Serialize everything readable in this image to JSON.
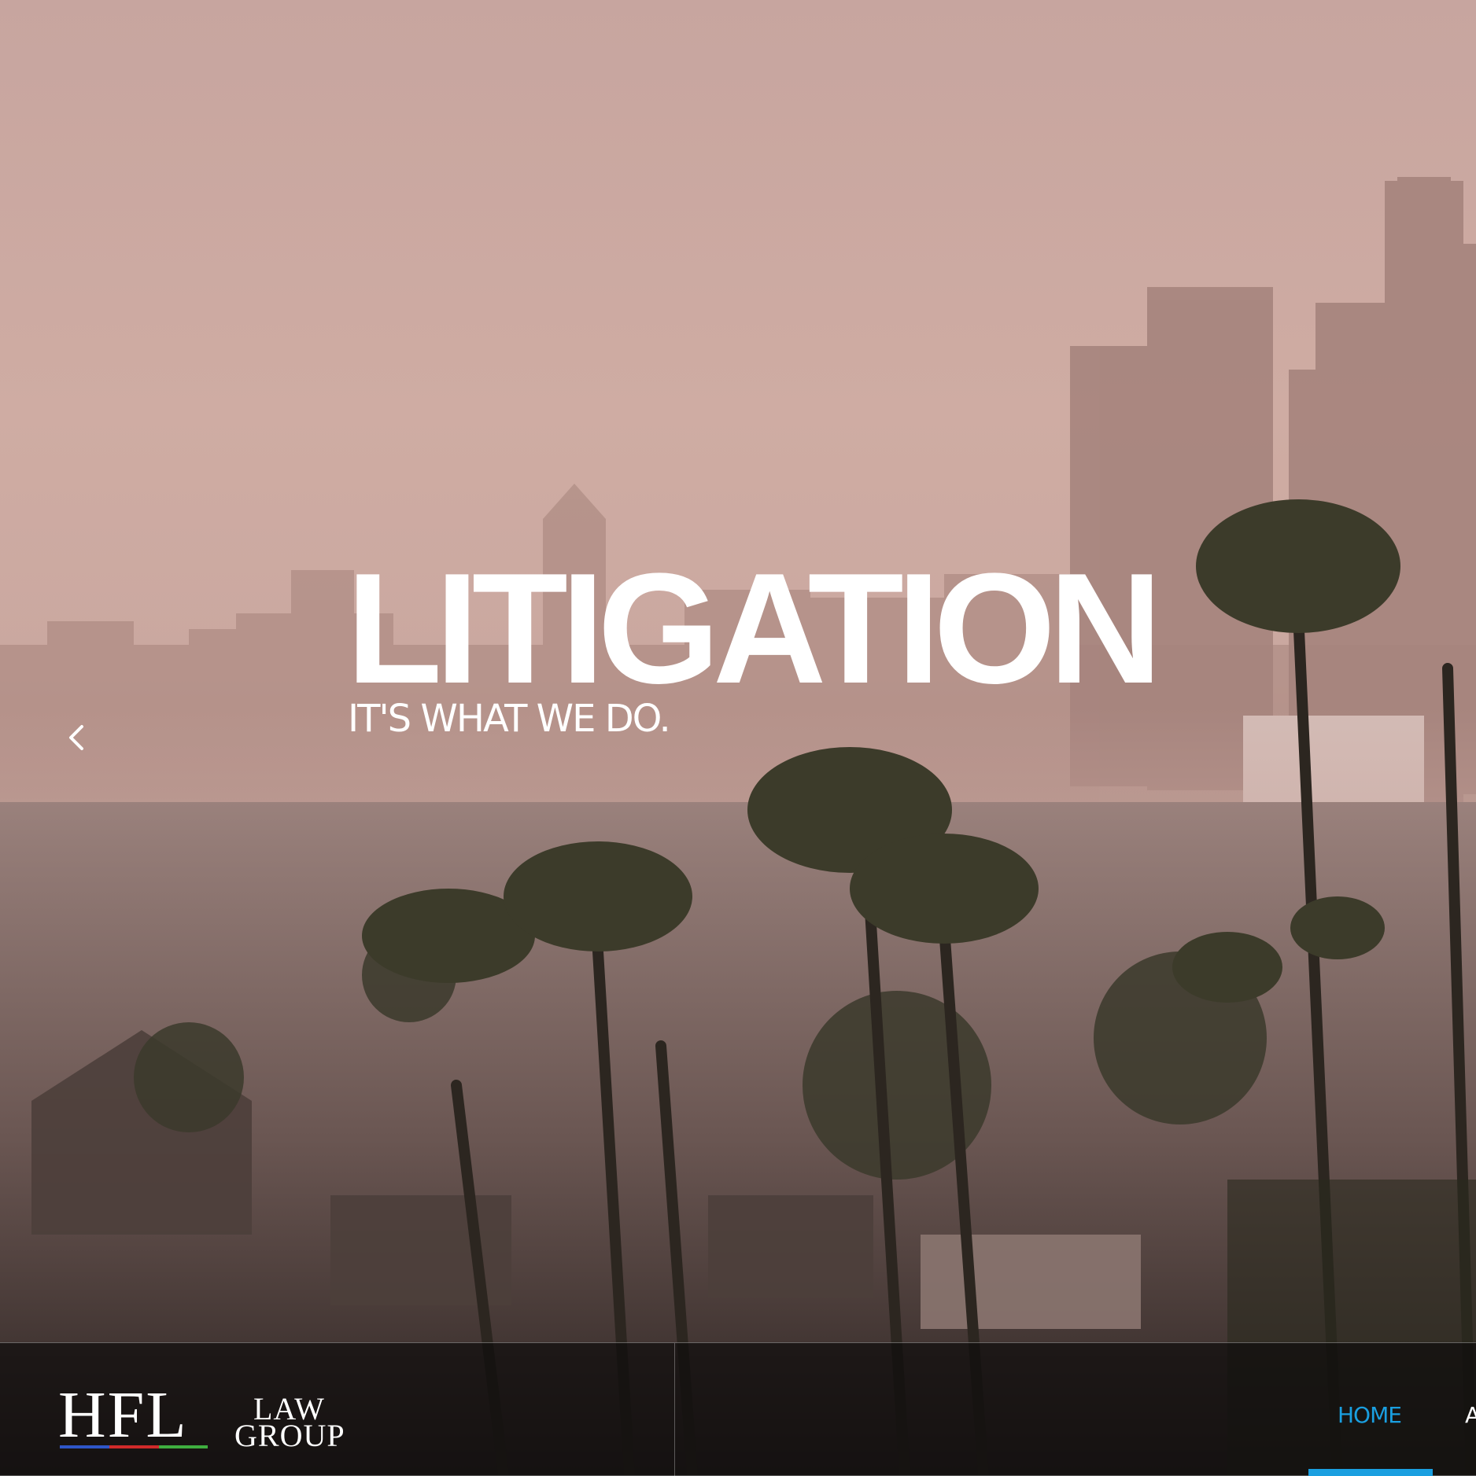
{
  "hero": {
    "title": "LITIGATION",
    "subtitle": "IT'S WHAT WE DO.",
    "prev_icon": "chevron-left-icon"
  },
  "logo": {
    "mark": "HFL",
    "line1": "LAW",
    "line2": "GROUP",
    "bar_colors": [
      "#2f56c8",
      "#d02a2a",
      "#3fae3f"
    ]
  },
  "nav": {
    "items": [
      {
        "label": "HOME",
        "active": true
      },
      {
        "label": "A",
        "active": false
      }
    ]
  },
  "colors": {
    "accent": "#1a9fe0",
    "navbar_bg": "rgba(12,10,10,0.68)"
  }
}
